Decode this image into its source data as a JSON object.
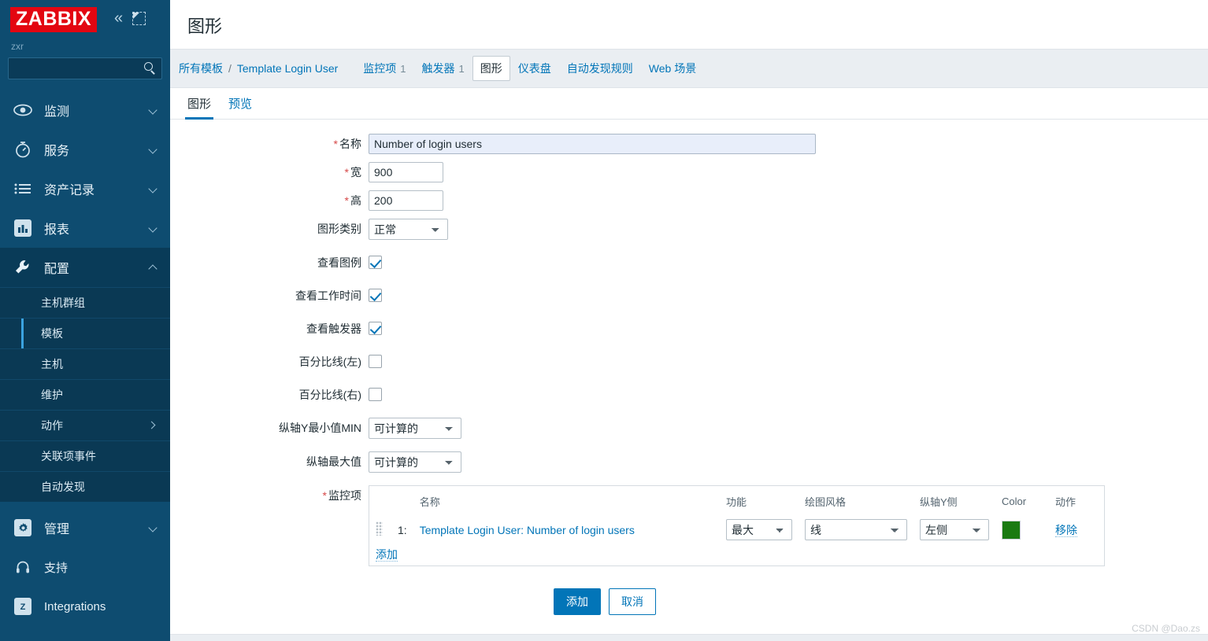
{
  "sidebar": {
    "logo": "ZABBIX",
    "user_label": "zxr",
    "collapse_icon": "double-chevron-left",
    "compact_icon": "compact-view",
    "search_placeholder": "",
    "search_value": "",
    "nav": [
      {
        "label": "监测",
        "icon": "eye-icon",
        "chevron": "down"
      },
      {
        "label": "服务",
        "icon": "stopwatch-icon",
        "chevron": "down"
      },
      {
        "label": "资产记录",
        "icon": "list-icon",
        "chevron": "down"
      },
      {
        "label": "报表",
        "icon": "bar-chart-icon",
        "chevron": "down"
      },
      {
        "label": "配置",
        "icon": "wrench-icon",
        "chevron": "up"
      }
    ],
    "submenu": [
      {
        "label": "主机群组",
        "active": false,
        "chevron": false
      },
      {
        "label": "模板",
        "active": true,
        "chevron": false
      },
      {
        "label": "主机",
        "active": false,
        "chevron": false
      },
      {
        "label": "维护",
        "active": false,
        "chevron": false
      },
      {
        "label": "动作",
        "active": false,
        "chevron": true
      },
      {
        "label": "关联项事件",
        "active": false,
        "chevron": false
      },
      {
        "label": "自动发现",
        "active": false,
        "chevron": false
      }
    ],
    "nav_bottom": [
      {
        "label": "管理",
        "icon": "gear-icon",
        "chevron": "down"
      },
      {
        "label": "支持",
        "icon": "headset-icon",
        "chevron": "none"
      },
      {
        "label": "Integrations",
        "icon": "zabbix-z-icon",
        "chevron": "none"
      }
    ]
  },
  "header": {
    "title": "图形"
  },
  "breadcrumb": {
    "root": "所有模板",
    "separator": "/",
    "current": "Template Login User"
  },
  "navlinks": [
    {
      "label": "监控项",
      "count": "1",
      "selected": false
    },
    {
      "label": "触发器",
      "count": "1",
      "selected": false
    },
    {
      "label": "图形",
      "count": "",
      "selected": true
    },
    {
      "label": "仪表盘",
      "count": "",
      "selected": false
    },
    {
      "label": "自动发现规则",
      "count": "",
      "selected": false
    },
    {
      "label": "Web 场景",
      "count": "",
      "selected": false
    }
  ],
  "tabs": [
    {
      "label": "图形",
      "active": true
    },
    {
      "label": "预览",
      "active": false
    }
  ],
  "form": {
    "name": {
      "label": "名称",
      "required": true,
      "value": "Number of login users"
    },
    "width": {
      "label": "宽",
      "required": true,
      "value": "900"
    },
    "height": {
      "label": "高",
      "required": true,
      "value": "200"
    },
    "graph_type": {
      "label": "图形类别",
      "value": "正常",
      "options": [
        "正常",
        "堆叠图",
        "饼图",
        "分解饼图"
      ]
    },
    "show_legend": {
      "label": "查看图例",
      "checked": true
    },
    "show_working_time": {
      "label": "查看工作时间",
      "checked": true
    },
    "show_triggers": {
      "label": "查看触发器",
      "checked": true
    },
    "percentile_left": {
      "label": "百分比线(左)",
      "checked": false
    },
    "percentile_right": {
      "label": "百分比线(右)",
      "checked": false
    },
    "y_min": {
      "label": "纵轴Y最小值MIN",
      "value": "可计算的",
      "options": [
        "可计算的",
        "固定的",
        "监控项"
      ]
    },
    "y_max": {
      "label": "纵轴最大值",
      "value": "可计算的",
      "options": [
        "可计算的",
        "固定的",
        "监控项"
      ]
    },
    "items": {
      "label": "监控项",
      "required": true,
      "columns": [
        "名称",
        "功能",
        "绘图风格",
        "纵轴Y侧",
        "Color",
        "动作"
      ],
      "rows": [
        {
          "index": "1:",
          "name": "Template Login User: Number of login users",
          "function": "最大",
          "draw_style": "线",
          "y_side": "左侧",
          "color": "#1A7A12",
          "action": "移除"
        }
      ],
      "add_label": "添加"
    }
  },
  "footer": {
    "submit": "添加",
    "cancel": "取消"
  },
  "watermark": "CSDN @Dao.zs"
}
